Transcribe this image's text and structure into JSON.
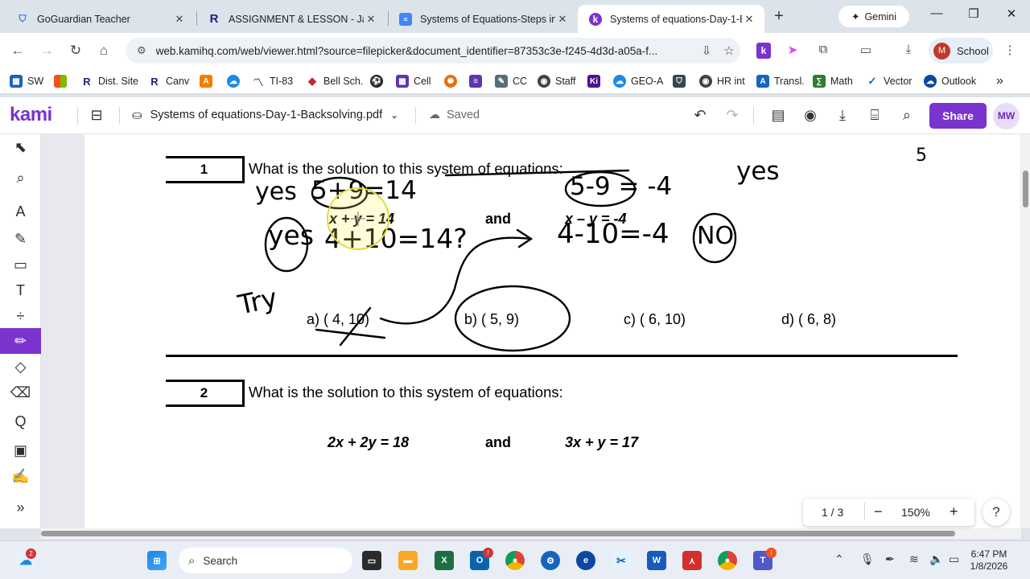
{
  "browser": {
    "tabs": [
      {
        "title": "GoGuardian Teacher",
        "icon": "shield-icon"
      },
      {
        "title": "ASSIGNMENT & LESSON - Jan",
        "icon": "r-logo-icon"
      },
      {
        "title": "Systems of Equations-Steps in",
        "icon": "doc-icon"
      },
      {
        "title": "Systems of equations-Day-1-B",
        "icon": "kami-k-icon"
      }
    ],
    "gemini_label": "Gemini",
    "url": "web.kamihq.com/web/viewer.html?source=filepicker&document_identifier=87353c3e-f245-4d3d-a05a-f...",
    "profile_initial": "M",
    "profile_label": "School"
  },
  "bookmarks": [
    {
      "label": "SW",
      "color": "#1565c0"
    },
    {
      "label": "",
      "color": "#f4b400"
    },
    {
      "label": "Dist. Site",
      "color": "#1a237e"
    },
    {
      "label": "Canv",
      "color": "#1a237e"
    },
    {
      "label": "",
      "color": "#f57c00"
    },
    {
      "label": "",
      "color": "#1e88e5"
    },
    {
      "label": "TI-83",
      "color": "#3949ab"
    },
    {
      "label": "Bell Sch.",
      "color": "#c62828"
    },
    {
      "label": "",
      "color": "#222222"
    },
    {
      "label": "Cell",
      "color": "#5e35b1"
    },
    {
      "label": "",
      "color": "#ef6c00"
    },
    {
      "label": "",
      "color": "#5e35b1"
    },
    {
      "label": "CC",
      "color": "#546e7a"
    },
    {
      "label": "Staff",
      "color": "#424242"
    },
    {
      "label": "",
      "color": "#4a148c"
    },
    {
      "label": "GEO-A",
      "color": "#1e88e5"
    },
    {
      "label": "",
      "color": "#37474f"
    },
    {
      "label": "HR int",
      "color": "#424242"
    },
    {
      "label": "Transl.",
      "color": "#1565c0"
    },
    {
      "label": "Math",
      "color": "#2e7d32"
    },
    {
      "label": "Vector",
      "color": "#1565c0"
    },
    {
      "label": "Outlook",
      "color": "#0d47a1"
    }
  ],
  "kami": {
    "logo": "kami",
    "document_name": "Systems of equations-Day-1-Backsolving.pdf",
    "save_status": "Saved",
    "share_label": "Share",
    "user_initials": "MW",
    "accent": "#7a33cc"
  },
  "document": {
    "q1": {
      "number": "1",
      "prompt": "What is the solution to this system of equations:",
      "eq1": "x + y = 14",
      "and": "and",
      "eq2": "x – y = -4",
      "choices": [
        "a)  ( 4, 10)",
        "b)  ( 5, 9)",
        "c)  ( 6, 10)",
        "d)  ( 6, 8)"
      ]
    },
    "q2": {
      "number": "2",
      "prompt": "What is the solution to this system of equations:",
      "eq1": "2x + 2y = 18",
      "and": "and",
      "eq2": "3x + y = 17"
    },
    "handwriting": {
      "yes1": "yes",
      "sub1": "5+9=14",
      "sub2": "5-9 = -4",
      "yes2": "yes",
      "yes3": "yes",
      "sub3": "4+10=14?",
      "sub4": "4-10=-4",
      "no": "NO",
      "try": "Try",
      "corner": "5"
    }
  },
  "viewer": {
    "page_indicator": "1 / 3",
    "zoom": "150%",
    "help": "?"
  },
  "taskbar": {
    "notification_count": "2",
    "search_placeholder": "Search",
    "time": "6:47 PM",
    "date": "1/8/2026"
  }
}
